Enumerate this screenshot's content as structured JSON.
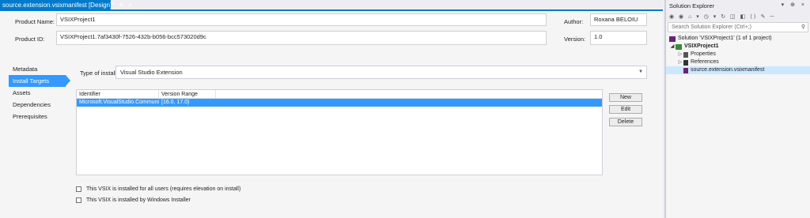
{
  "doc_tab": {
    "label": "source.extension.vsixmanifest [Design]*",
    "pin": "⊕",
    "close": "×"
  },
  "form": {
    "product_name_label": "Product Name:",
    "product_name": "VSIXProject1",
    "product_id_label": "Product ID:",
    "product_id": "VSIXProject1.7af3430f-7526-432b-b056-bcc573020d9c",
    "author_label": "Author:",
    "author": "Roxana BELOIU",
    "version_label": "Version:",
    "version": "1.0"
  },
  "nav": [
    "Metadata",
    "Install Targets",
    "Assets",
    "Dependencies",
    "Prerequisites"
  ],
  "install": {
    "type_label": "Type of install:",
    "type_value": "Visual Studio Extension",
    "columns": [
      "Identifier",
      "Version Range"
    ],
    "rows": [
      {
        "identifier": "Microsoft.VisualStudio.Community",
        "range": "[16.0, 17.0)"
      }
    ],
    "buttons": {
      "new": "New",
      "edit": "Edit",
      "delete": "Delete"
    },
    "checkbox_all_users": "This VSIX is installed for all users (requires elevation on install)",
    "checkbox_windows_installer": "This VSIX is installed by Windows Installer"
  },
  "solution_explorer": {
    "title": "Solution Explorer",
    "title_icons": "▾ ⊕ ×",
    "toolbar_icons": "◉ ◉ ⌂ ▾ ◷ ▾ ↻ ◫ ◧ ⟨⟩ ✎ ─",
    "search_placeholder": "Search Solution Explorer (Ctrl+;)",
    "tree": {
      "solution": "Solution 'VSIXProject1' (1 of 1 project)",
      "project": "VSIXProject1",
      "properties": "Properties",
      "references": "References",
      "manifest": "source.extension.vsixmanifest"
    }
  }
}
